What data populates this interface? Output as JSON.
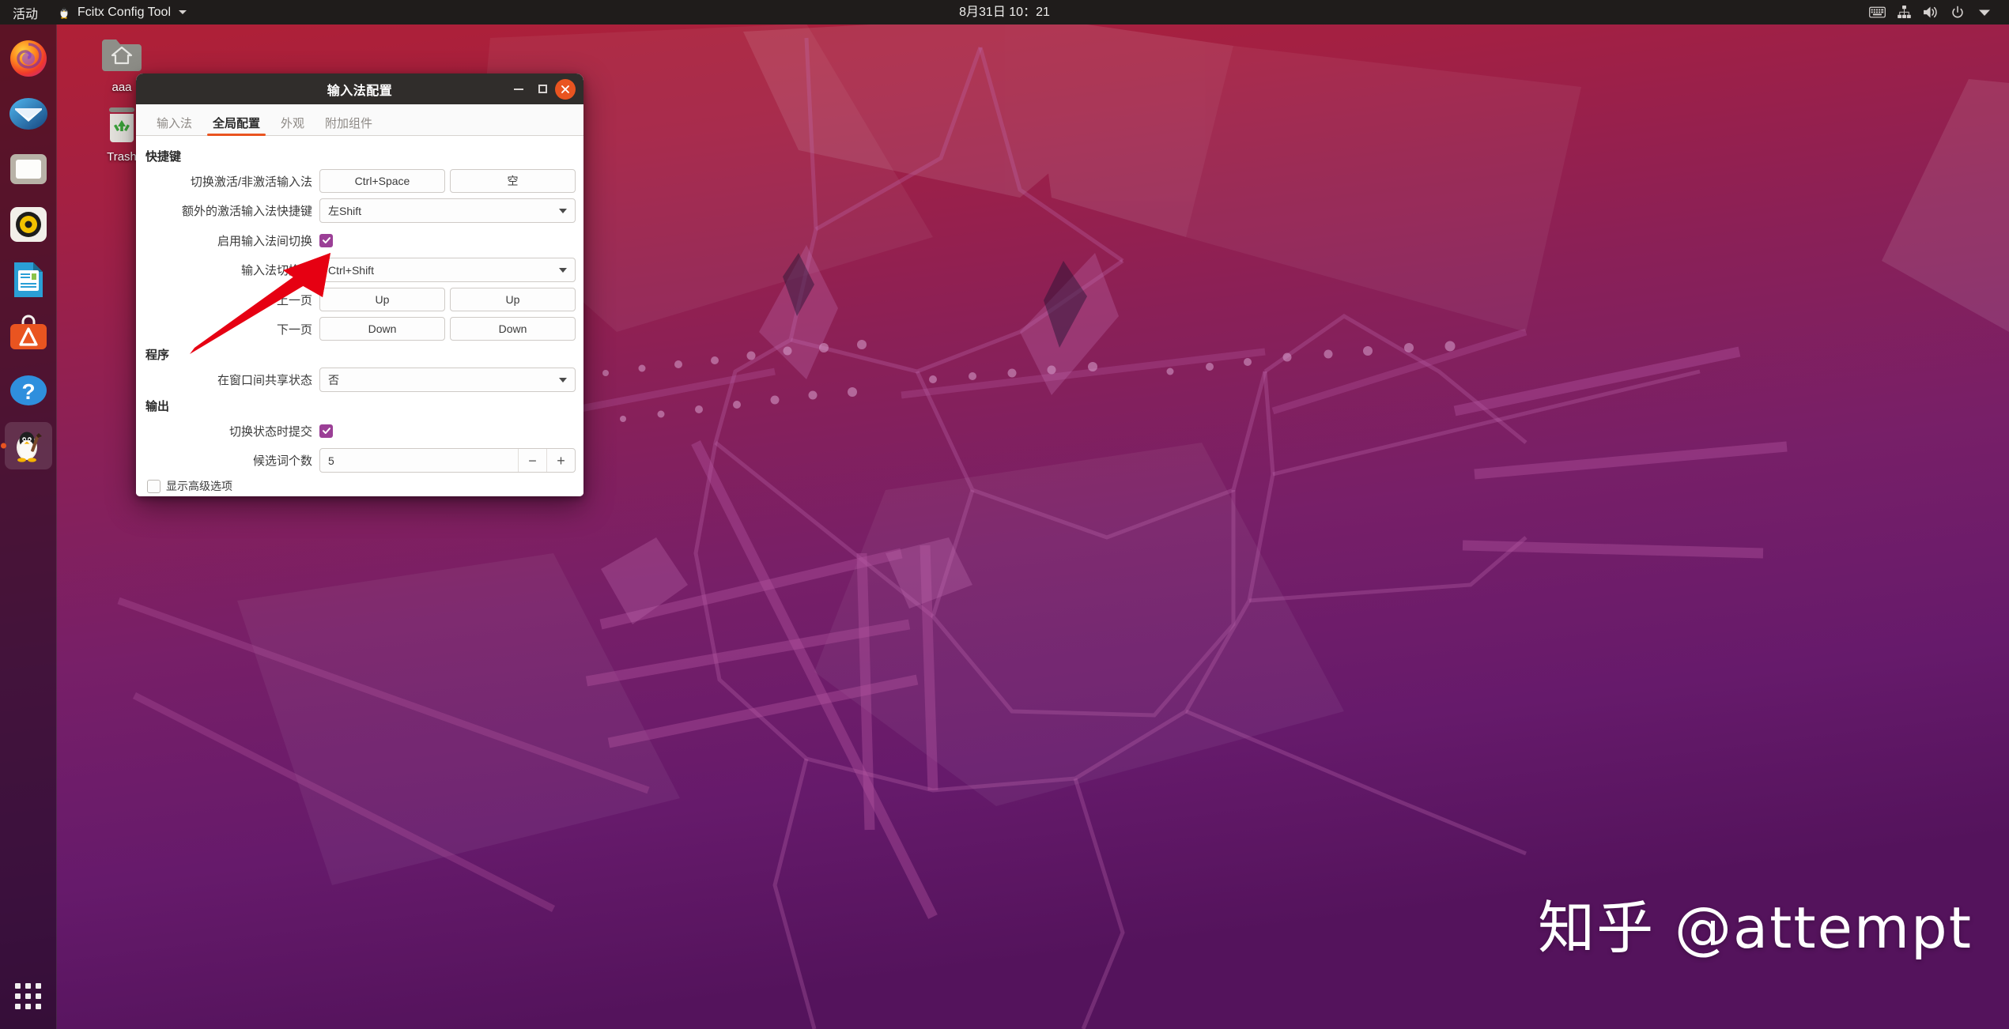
{
  "topbar": {
    "activities": "活动",
    "app_name": "Fcitx Config Tool",
    "app_icon": "penguin-icon",
    "caret_icon": "chevron-down-icon",
    "clock": "8月31日 10：21",
    "tray": [
      {
        "name": "keyboard-icon",
        "label": "keyboard"
      },
      {
        "name": "network-icon",
        "label": "network"
      },
      {
        "name": "volume-icon",
        "label": "volume"
      },
      {
        "name": "power-icon",
        "label": "power"
      },
      {
        "name": "chevron-down-icon",
        "label": "menu"
      }
    ]
  },
  "dock": {
    "items": [
      {
        "name": "firefox",
        "label": "Firefox",
        "running": false
      },
      {
        "name": "thunderbird",
        "label": "Thunderbird",
        "running": false
      },
      {
        "name": "files",
        "label": "Files",
        "running": false
      },
      {
        "name": "rhythmbox",
        "label": "Rhythmbox",
        "running": false
      },
      {
        "name": "libreoffice-writer",
        "label": "LibreOffice Writer",
        "running": false
      },
      {
        "name": "ubuntu-software",
        "label": "Ubuntu Software",
        "running": false
      },
      {
        "name": "help",
        "label": "Help",
        "running": false
      },
      {
        "name": "fcitx-config-tool",
        "label": "Fcitx Config Tool",
        "running": true
      }
    ],
    "show_apps_label": "Show Applications"
  },
  "desktop_icons": [
    {
      "name": "home-folder",
      "label": "aaa"
    },
    {
      "name": "trash",
      "label": "Trash"
    }
  ],
  "dialog": {
    "title": "输入法配置",
    "window_buttons": {
      "minimize": "minimize-icon",
      "maximize": "maximize-icon",
      "close": "close-icon"
    },
    "tabs": [
      {
        "label": "输入法",
        "active": false
      },
      {
        "label": "全局配置",
        "active": true
      },
      {
        "label": "外观",
        "active": false
      },
      {
        "label": "附加组件",
        "active": false
      }
    ],
    "sections": [
      {
        "heading": "快捷键",
        "rows": [
          {
            "type": "buttons",
            "label": "切换激活/非激活输入法",
            "values": [
              "Ctrl+Space",
              "空"
            ]
          },
          {
            "type": "combo",
            "label": "额外的激活输入法快捷键",
            "value": "左Shift"
          },
          {
            "type": "checkbox",
            "label": "启用输入法间切换",
            "checked": true
          },
          {
            "type": "combo",
            "label": "输入法切换键",
            "value": "Ctrl+Shift"
          },
          {
            "type": "buttons",
            "label": "上一页",
            "values": [
              "Up",
              "Up"
            ]
          },
          {
            "type": "buttons",
            "label": "下一页",
            "values": [
              "Down",
              "Down"
            ]
          }
        ]
      },
      {
        "heading": "程序",
        "rows": [
          {
            "type": "combo",
            "label": "在窗口间共享状态",
            "value": "否"
          }
        ]
      },
      {
        "heading": "输出",
        "rows": [
          {
            "type": "checkbox",
            "label": "切换状态时提交",
            "checked": true
          },
          {
            "type": "spinner",
            "label": "候选词个数",
            "value": "5",
            "decrement": "−",
            "increment": "+"
          }
        ]
      }
    ],
    "advanced": {
      "label": "显示高级选项",
      "checked": false
    }
  },
  "annotation": {
    "type": "red-arrow",
    "color": "#e60012",
    "points_to": "输入法切换键"
  },
  "watermark": "知乎 @attempt",
  "colors": {
    "accent": "#e95420",
    "checkbox": "#9b3f96",
    "titlebar": "#302d2b",
    "topbar": "#1f1c1b",
    "annotation": "#e60012",
    "wallpaper_top": "#b22034",
    "wallpaper_bottom": "#54135c"
  }
}
